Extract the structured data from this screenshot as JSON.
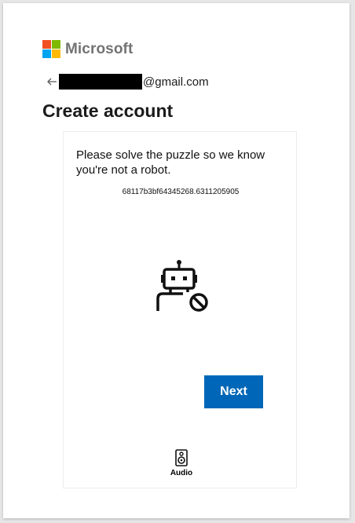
{
  "brand": {
    "name": "Microsoft",
    "colors": {
      "red": "#f25022",
      "green": "#7fba00",
      "blue": "#00a4ef",
      "yellow": "#ffb900"
    }
  },
  "account": {
    "back_icon": "arrow-left-icon",
    "email_suffix": "@gmail.com"
  },
  "page": {
    "title": "Create account"
  },
  "puzzle": {
    "instruction": "Please solve the puzzle so we know you're not a robot.",
    "session_id": "68117b3bf64345268.6311205905",
    "robot_icon": "robot-blocked-icon",
    "next_label": "Next",
    "audio_label": "Audio",
    "audio_icon": "speaker-icon",
    "accent_color": "#0067b8"
  }
}
